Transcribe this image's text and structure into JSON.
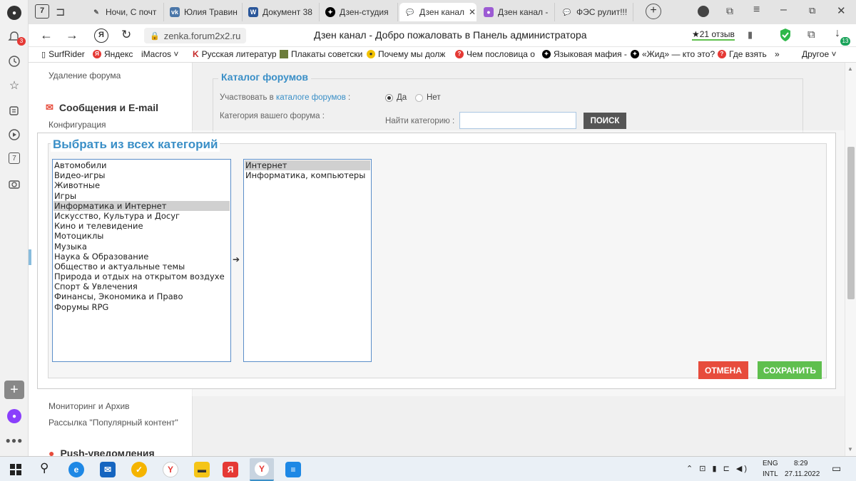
{
  "browser": {
    "tabs": [
      {
        "label": "Ночи, С почт",
        "fav": "pencil-icon"
      },
      {
        "label": "Юлия Травин",
        "fav": "vk-icon"
      },
      {
        "label": "Документ 38",
        "fav": "word-icon"
      },
      {
        "label": "Дзен-студия",
        "fav": "dzen-icon"
      },
      {
        "label": "Дзен канал",
        "fav": "chat-icon",
        "active": true
      },
      {
        "label": "Дзен канал -",
        "fav": "forum-icon"
      },
      {
        "label": "ФЭС рулит!!!",
        "fav": "chat-icon"
      }
    ],
    "tab_counter": "7",
    "url": "zenka.forum2x2.ru",
    "page_title": "Дзен канал - Добро пожаловать в Панель администратора",
    "reviews": "★21 отзыв",
    "notif_badge": "3",
    "downloads_badge": "13",
    "left_counter": "7",
    "bookmarks": [
      "SurfRider",
      "Яндекс",
      "iMacros ˅",
      "Русская литератур",
      "Плакаты советски",
      "Почему мы долж",
      "Чем пословица о",
      "Языковая мафия -",
      "«Жид» — кто это?",
      "Где взять"
    ],
    "bookmarks_more": "»",
    "bookmarks_other": "Другое ˅"
  },
  "sidebar": {
    "remove_forum": "Удаление форума",
    "messages_header": "Сообщения и E-mail",
    "config": "Конфигурация",
    "monitoring": "Мониторинг и Архив",
    "newsletter": "Рассылка \"Популярный контент\"",
    "push": "Push-уведомления"
  },
  "catalog": {
    "legend": "Каталог форумов",
    "participate_label_pre": "Участвовать в ",
    "participate_link": "каталоге форумов",
    "participate_label_post": " :",
    "yes": "Да",
    "no": "Нет",
    "category_label": "Категория вашего форума :",
    "find_label": "Найти категорию :",
    "search_button": "ПОИСК"
  },
  "dialog": {
    "title": "Выбрать из всех категорий",
    "categories": [
      "Автомобили",
      "Видео-игры",
      "Животные",
      "Игры",
      "Информатика и Интернет",
      "Искусство, Культура и Досуг",
      "Кино и телевидение",
      "Мотоциклы",
      "Музыка",
      "Наука & Образование",
      "Общество и актуальные темы",
      "Природа и отдых на открытом воздухе",
      "Спорт & Увлечения",
      "Финансы, Экономика и Право",
      "Форумы RPG"
    ],
    "selected_category": "Информатика и Интернет",
    "subcategories": [
      "Интернет",
      "Информатика, компьютеры"
    ],
    "selected_subcategory": "Интернет",
    "arrow": "➔",
    "cancel": "ОТМЕНА",
    "save": "СОХРАНИТЬ"
  },
  "taskbar": {
    "lang": "ENG",
    "layout": "INTL",
    "time": "8:29",
    "date": "27.11.2022"
  },
  "colors": {
    "accent_blue": "#3a8fc7",
    "cancel_red": "#e74c3c",
    "save_green": "#5fbf4e",
    "search_btn": "#555555"
  }
}
